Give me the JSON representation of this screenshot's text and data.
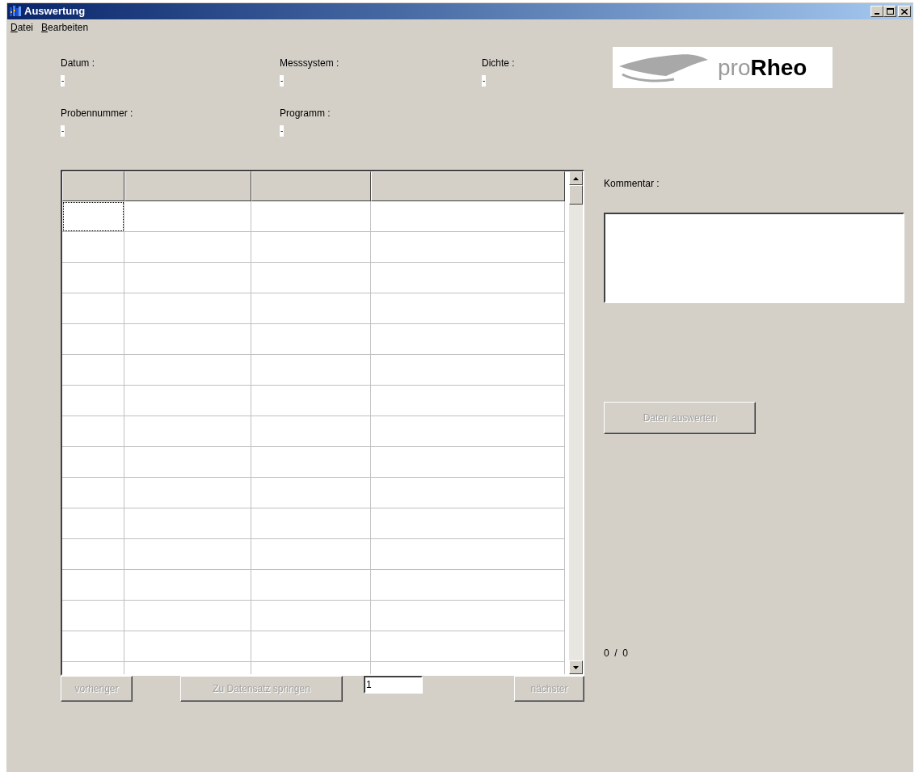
{
  "window": {
    "title": "Auswertung"
  },
  "menu": [
    {
      "label": "Datei"
    },
    {
      "label": "Bearbeiten"
    }
  ],
  "fields": [
    {
      "label": "Datum :",
      "value": "-"
    },
    {
      "label": "Messsystem :",
      "value": "-"
    },
    {
      "label": "Dichte :",
      "value": "-"
    },
    {
      "label": "Probennummer :",
      "value": "-"
    },
    {
      "label": "Programm :",
      "value": "-"
    }
  ],
  "logo": {
    "text": "pro**Rheo**"
  },
  "grid": {
    "rows": [
      {
        "focused": true
      },
      {
        "focused": false
      },
      {
        "focused": false
      },
      {
        "focused": false
      },
      {
        "focused": false
      },
      {
        "focused": false
      },
      {
        "focused": false
      },
      {
        "focused": false
      },
      {
        "focused": false
      },
      {
        "focused": false
      },
      {
        "focused": false
      },
      {
        "focused": false
      },
      {
        "focused": false
      },
      {
        "focused": false
      },
      {
        "focused": false
      },
      {
        "focused": false
      }
    ]
  },
  "navigation": {
    "previous": {
      "label": "vorheriger",
      "disabled": true
    },
    "jump": {
      "label": "Zu Datensatz springen",
      "disabled": true
    },
    "record": {
      "value": "1"
    },
    "next": {
      "label": "nächster",
      "disabled": true
    }
  },
  "comment": {
    "label": "Kommentar :"
  },
  "evaluate_button": {
    "label": "Daten auswerten",
    "disabled": true
  },
  "counter": "0  /  0"
}
